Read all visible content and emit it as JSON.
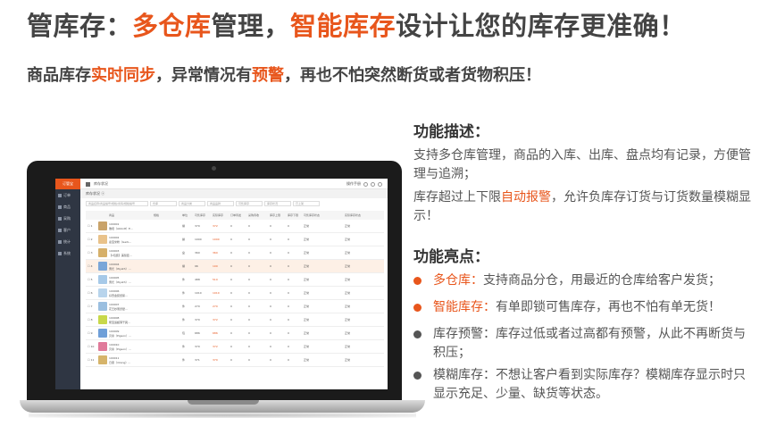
{
  "headline": {
    "p1": "管库存：",
    "p2": "多仓库",
    "p3": "管理，",
    "p4": "智能库存",
    "p5": "设计让您的库存更准确！"
  },
  "subline": {
    "p1": "商品库存",
    "p2": "实时同步",
    "p3": "，异常情况有",
    "p4": "预警",
    "p5": "，再也不怕突然断货或者货物积压！"
  },
  "app": {
    "logo": "订管宝",
    "sidebar": [
      "订单",
      "商品",
      "采购",
      "客户",
      "统计",
      "系统"
    ],
    "breadcrumb": "库存状况",
    "top_right": "操作手册",
    "tab": "库存状况 ⓧ",
    "filters": [
      "商品名称/商品编号/规格/条码/规格编号",
      "仓库",
      "商品分类",
      "商品品牌",
      "可售库存",
      "库存状况",
      "已上架"
    ],
    "columns": [
      "商品",
      "规格",
      "单位",
      "可售库存",
      "实际库存",
      "订单待发",
      "采购待收",
      "库存上限",
      "库存下限",
      "可售库存状态",
      "实际库存状态"
    ],
    "rows": [
      {
        "code": "100001",
        "name": "雅培（Abbott）E…",
        "unit": "罐",
        "sale": "370",
        "actual": "372",
        "o": "0",
        "p": "0",
        "up": "0",
        "low": "0",
        "s1": "正常",
        "s2": "正常",
        "color": "#c9a36a"
      },
      {
        "code": "100002",
        "name": "嘉宝米粉（Gerb…",
        "unit": "袋",
        "sale": "1000",
        "actual": "1000",
        "o": "0",
        "p": "0",
        "up": "0",
        "low": "0",
        "s1": "正常",
        "s2": "正常",
        "color": "#e9c28a"
      },
      {
        "code": "100003",
        "name": "【1包装】美赞臣…",
        "unit": "盒",
        "sale": "360",
        "actual": "360",
        "o": "0",
        "p": "0",
        "up": "0",
        "low": "0",
        "s1": "正常",
        "s2": "正常",
        "color": "#d6b06a"
      },
      {
        "code": "100004",
        "name": "惠氏（Wyeth）…",
        "unit": "罐",
        "sale": "96",
        "actual": "100",
        "o": "0",
        "p": "0",
        "up": "0",
        "low": "0",
        "s1": "正常",
        "s2": "正常",
        "color": "#7aa6d8"
      },
      {
        "code": "100005",
        "name": "惠氏（Wyeth）…",
        "unit": "件",
        "sale": "488",
        "actual": "510",
        "o": "0",
        "p": "0",
        "up": "0",
        "low": "0",
        "s1": "正常",
        "s2": "正常",
        "color": "#a6c9e8"
      },
      {
        "code": "100006",
        "name": "好奇金装纸尿…",
        "unit": "件",
        "sale": "1010",
        "actual": "1010",
        "o": "0",
        "p": "0",
        "up": "0",
        "low": "0",
        "s1": "正常",
        "s2": "正常",
        "color": "#b8d4ec"
      },
      {
        "code": "100007",
        "name": "花王妙而舒婴…",
        "unit": "件",
        "sale": "270",
        "actual": "270",
        "o": "0",
        "p": "0",
        "up": "0",
        "low": "0",
        "s1": "正常",
        "s2": "正常",
        "color": "#9bbfe0"
      },
      {
        "code": "100008",
        "name": "帮宝适超薄干爽…",
        "unit": "件",
        "sale": "370",
        "actual": "372",
        "o": "0",
        "p": "0",
        "up": "0",
        "low": "0",
        "s1": "正常",
        "s2": "正常",
        "color": "#c8d84a"
      },
      {
        "code": "100009",
        "name": "贝亲（Pigeon）…",
        "unit": "包",
        "sale": "686",
        "actual": "686",
        "o": "0",
        "p": "0",
        "up": "0",
        "low": "0",
        "s1": "正常",
        "s2": "正常",
        "color": "#6f9fd8"
      },
      {
        "code": "100010",
        "name": "贝亲（Pigeon）…",
        "unit": "件",
        "sale": "370",
        "actual": "372",
        "o": "0",
        "p": "0",
        "up": "0",
        "low": "0",
        "s1": "正常",
        "s2": "正常",
        "color": "#e07a9a"
      },
      {
        "code": "100011",
        "name": "日康（rikang）…",
        "unit": "件",
        "sale": "371",
        "actual": "370",
        "o": "0",
        "p": "0",
        "up": "0",
        "low": "0",
        "s1": "正常",
        "s2": "正常",
        "color": "#d6b46a"
      }
    ]
  },
  "desc": {
    "title": "功能描述：",
    "para1": "支持多仓库管理，商品的入库、出库、盘点均有记录，方便管理与追溯；",
    "para2_p1": "库存超过上下限",
    "para2_p2": "自动报警",
    "para2_p3": "，允许负库存订货与订货数量模糊显示！"
  },
  "highlights": {
    "title": "功能亮点：",
    "items": [
      {
        "label": "多仓库：",
        "text": "支持商品分仓，用最近的仓库给客户发货；",
        "accent": true
      },
      {
        "label": "智能库存：",
        "text": "有单即锁可售库存，再也不怕有单无货！",
        "accent": true
      },
      {
        "label": "库存预警：",
        "text": "库存过低或者过高都有预警，从此不再断货与积压；",
        "accent": false
      },
      {
        "label": "模糊库存：",
        "text": "不想让客户看到实际库存？模糊库存显示时只显示充足、少量、缺货等状态。",
        "accent": false
      }
    ]
  },
  "colors": {
    "accent": "#e8561c",
    "dark_bullet": "#555555"
  }
}
